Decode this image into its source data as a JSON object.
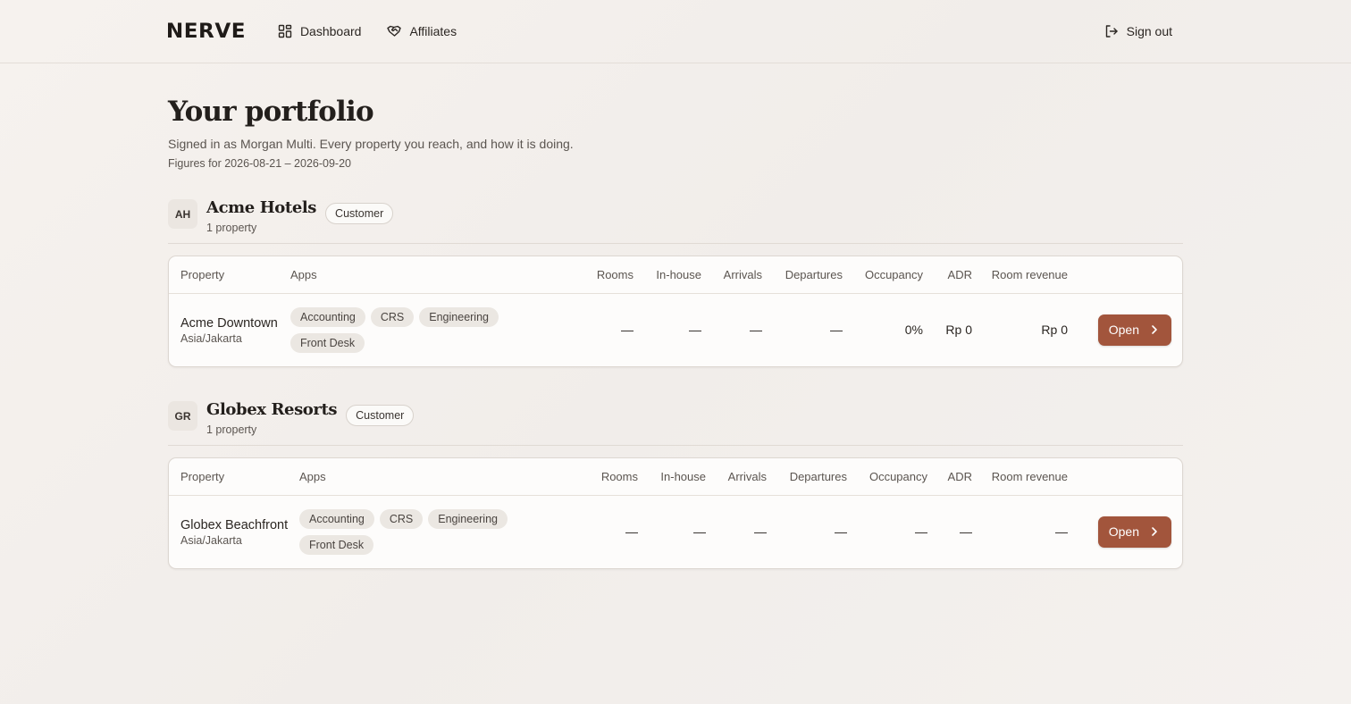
{
  "brand": "NERVE",
  "nav": {
    "dashboard": "Dashboard",
    "affiliates": "Affiliates",
    "signout": "Sign out"
  },
  "header": {
    "title": "Your portfolio",
    "subtitle": "Signed in as Morgan Multi. Every property you reach, and how it is doing.",
    "period": "Figures for 2026-08-21 – 2026-09-20"
  },
  "columns": {
    "property": "Property",
    "apps": "Apps",
    "rooms": "Rooms",
    "inhouse": "In-house",
    "arrivals": "Arrivals",
    "departures": "Departures",
    "occupancy": "Occupancy",
    "adr": "ADR",
    "revenue": "Room revenue"
  },
  "groups": [
    {
      "initials": "AH",
      "name": "Acme Hotels",
      "count": "1 property",
      "badge": "Customer",
      "row": {
        "name": "Acme Downtown",
        "timezone": "Asia/Jakarta",
        "apps": [
          "Accounting",
          "CRS",
          "Engineering",
          "Front Desk"
        ],
        "rooms": "—",
        "inhouse": "—",
        "arrivals": "—",
        "departures": "—",
        "occupancy": "0%",
        "adr": "Rp 0",
        "revenue": "Rp 0",
        "action": "Open"
      }
    },
    {
      "initials": "GR",
      "name": "Globex Resorts",
      "count": "1 property",
      "badge": "Customer",
      "row": {
        "name": "Globex Beachfront",
        "timezone": "Asia/Jakarta",
        "apps": [
          "Accounting",
          "CRS",
          "Engineering",
          "Front Desk"
        ],
        "rooms": "—",
        "inhouse": "—",
        "arrivals": "—",
        "departures": "—",
        "occupancy": "—",
        "adr": "—",
        "revenue": "—",
        "action": "Open"
      }
    }
  ],
  "colors": {
    "accent": "#a2553c",
    "background": "#f4f0ec",
    "pill": "#ebe7e2"
  },
  "icons": {
    "dashboard": "grid-icon",
    "affiliates": "handshake-icon",
    "signout": "logout-icon",
    "open": "chevron-right-icon"
  }
}
